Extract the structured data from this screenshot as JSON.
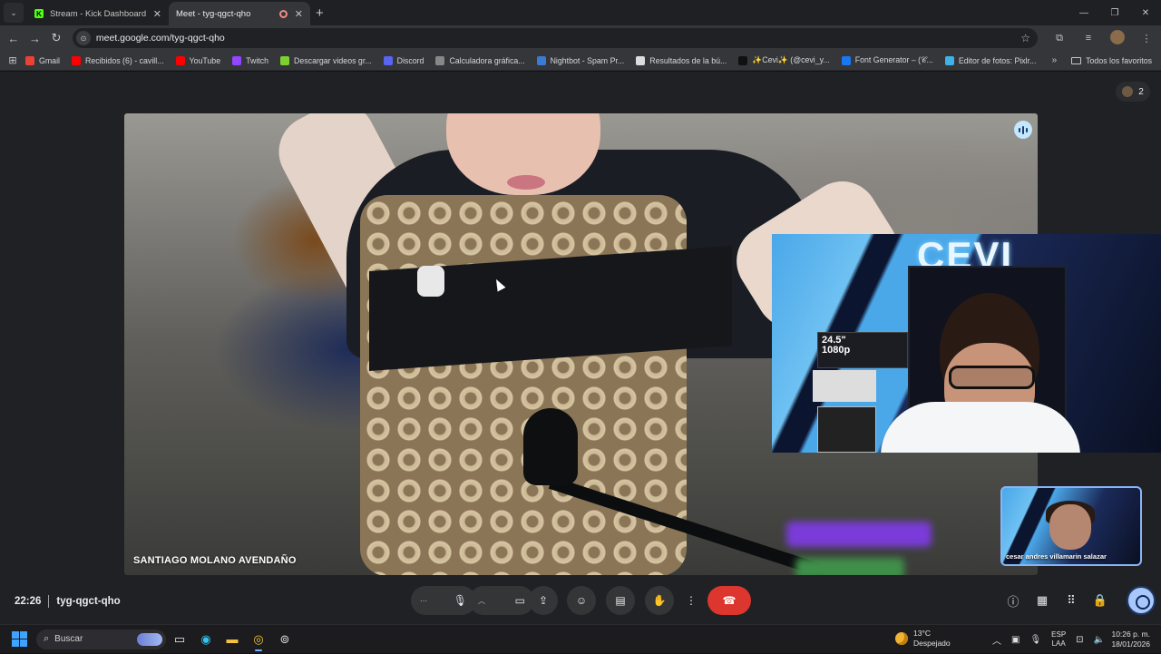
{
  "browser": {
    "tabs": [
      {
        "label": "Stream - Kick Dashboard",
        "active": false
      },
      {
        "label": "Meet - tyg-qgct-qho",
        "active": true
      }
    ],
    "url": "meet.google.com/tyg-qgct-qho",
    "bookmarks": [
      {
        "label": "Gmail",
        "icon": "gmail-icon",
        "color": "#ea4335"
      },
      {
        "label": "Recibidos (6) - cavill...",
        "icon": "youtube-icon",
        "color": "#ff0000"
      },
      {
        "label": "YouTube",
        "icon": "youtube-icon",
        "color": "#ff0000"
      },
      {
        "label": "Twitch",
        "icon": "twitch-icon",
        "color": "#9146ff"
      },
      {
        "label": "Descargar videos gr...",
        "icon": "download-icon",
        "color": "#7cd12f"
      },
      {
        "label": "Discord",
        "icon": "discord-icon",
        "color": "#5865f2"
      },
      {
        "label": "Calculadora gráfica...",
        "icon": "calculator-icon",
        "color": "#888888"
      },
      {
        "label": "Nightbot - Spam Pr...",
        "icon": "nightbot-icon",
        "color": "#3a7bd5"
      },
      {
        "label": "Resultados de la bú...",
        "icon": "search-result-icon",
        "color": "#dddddd"
      },
      {
        "label": "✨Cevi✨ (@cevi_y...",
        "icon": "tiktok-icon",
        "color": "#111111"
      },
      {
        "label": "Font Generator – (𝒞...",
        "icon": "font-icon",
        "color": "#1877f2"
      },
      {
        "label": "Editor de fotos: Pixlr...",
        "icon": "pixlr-icon",
        "color": "#3fb2e8"
      }
    ],
    "all_bookmarks_label": "Todos los favoritos"
  },
  "meet": {
    "participant_count": "2",
    "main_speaker_name": "SANTIAGO MOLANO AVENDAÑO",
    "self_view_name": "cesar andres villamarin salazar",
    "time": "22:26",
    "meeting_code": "tyg-qgct-qho"
  },
  "taskbar": {
    "search_placeholder": "Buscar",
    "weather_temp": "13°C",
    "weather_desc": "Despejado",
    "lang_top": "ESP",
    "lang_bottom": "LAA",
    "clock_time": "10:26 p. m.",
    "clock_date": "18/01/2026"
  },
  "colors": {
    "leave_button": "#dc362e",
    "self_view_border": "#8ab4f8",
    "accent": "#a8c7fa"
  }
}
